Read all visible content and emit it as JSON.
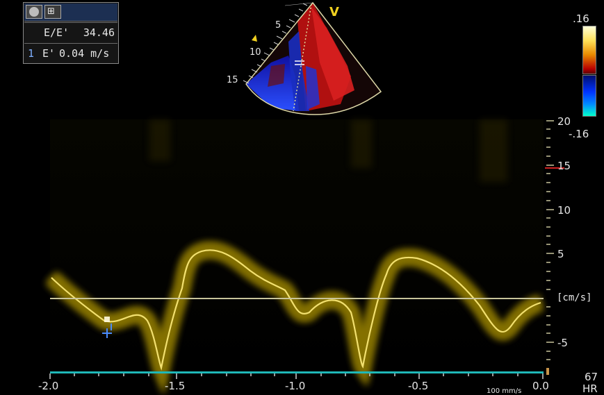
{
  "panel": {
    "toolbar_icon_a": "record-icon",
    "toolbar_icon_b": "caliper-icon",
    "toolbar_glyph": "⊞",
    "ratio_label": "E/E'",
    "ratio_value": "34.46",
    "meas_index": "1",
    "meas_label": "E'",
    "meas_value": "0.04 m/s"
  },
  "sector": {
    "marker": "V",
    "depth_ticks": [
      "5",
      "10",
      "15"
    ]
  },
  "color_scale": {
    "top": ".16",
    "bottom": "-.16",
    "colors": {
      "positive": "#e8c000",
      "negative": "#1840ff"
    }
  },
  "velocity_axis": {
    "ticks": [
      "20",
      "15",
      "10",
      "5",
      "[cm/s]",
      "-5"
    ]
  },
  "time_axis": {
    "ticks": [
      "-2.0",
      "-1.5",
      "-1.0",
      "-0.5",
      "0.0"
    ],
    "sweep_speed": "100 mm/s"
  },
  "heart_rate": {
    "value": "67",
    "label": "HR"
  },
  "colors": {
    "trace": "#e9d23a",
    "baseline": "#c8c49a",
    "ecg": "#1fb8b8",
    "cursor": "#4a8cff"
  }
}
